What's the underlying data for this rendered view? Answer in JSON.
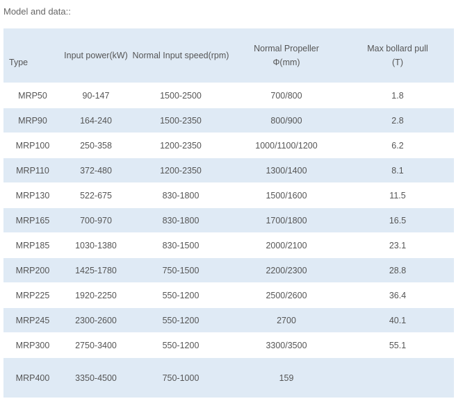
{
  "caption": "Model and data::",
  "table": {
    "headers": {
      "type": "Type",
      "input_power": "Input power(kW)",
      "input_speed": "Normal Input speed(rpm)",
      "propeller_line1": "Normal Propeller",
      "propeller_line2": "Φ(mm)",
      "bollard_line1": "Max bollard pull",
      "bollard_line2": "(T)"
    },
    "rows": [
      [
        "MRP50",
        "90-147",
        "1500-2500",
        "700/800",
        "1.8"
      ],
      [
        "MRP90",
        "164-240",
        "1500-2350",
        "800/900",
        "2.8"
      ],
      [
        "MRP100",
        "250-358",
        "1200-2350",
        "1000/1100/1200",
        "6.2"
      ],
      [
        "MRP110",
        "372-480",
        "1200-2350",
        "1300/1400",
        "8.1"
      ],
      [
        "MRP130",
        "522-675",
        "830-1800",
        "1500/1600",
        "11.5"
      ],
      [
        "MRP165",
        "700-970",
        "830-1800",
        "1700/1800",
        "16.5"
      ],
      [
        "MRP185",
        "1030-1380",
        "830-1500",
        "2000/2100",
        "23.1"
      ],
      [
        "MRP200",
        "1425-1780",
        "750-1500",
        "2200/2300",
        "28.8"
      ],
      [
        "MRP225",
        "1920-2250",
        "550-1200",
        "2500/2600",
        "36.4"
      ],
      [
        "MRP245",
        "2300-2600",
        "550-1200",
        "2700",
        "40.1"
      ],
      [
        "MRP300",
        "2750-3400",
        "550-1200",
        "3300/3500",
        "55.1"
      ],
      [
        "MRP400",
        "3350-4500",
        "750-1000",
        "159",
        ""
      ]
    ]
  }
}
